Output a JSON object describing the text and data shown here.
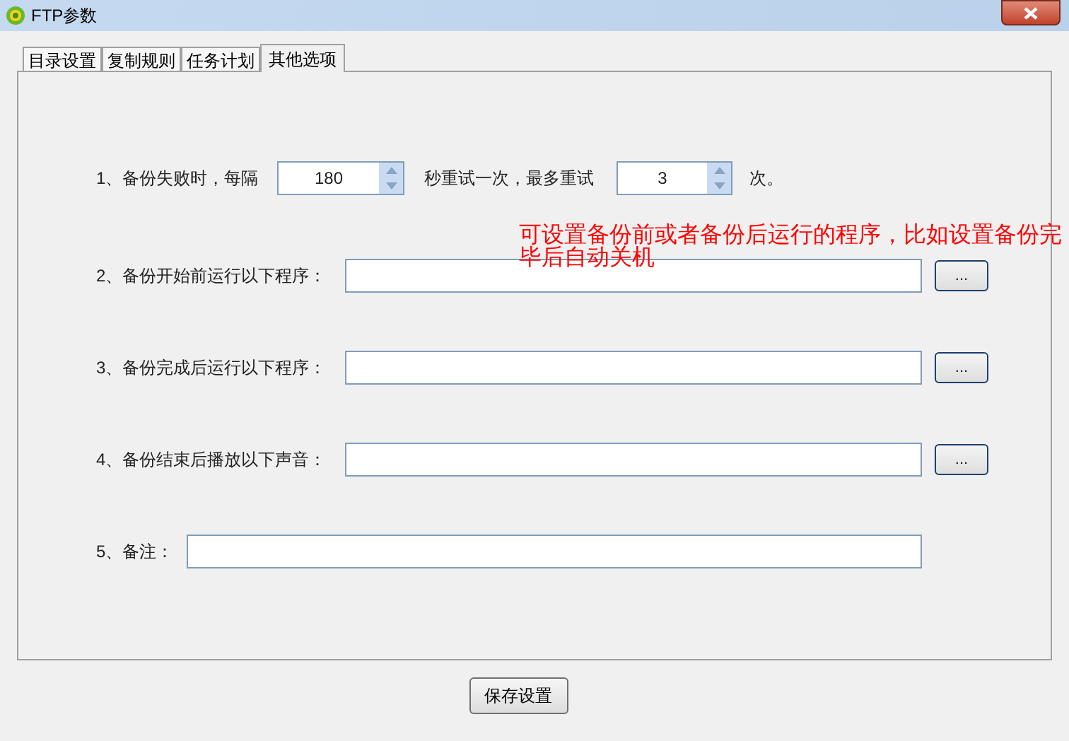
{
  "window": {
    "title": "FTP参数"
  },
  "tabs": [
    {
      "label": "目录设置",
      "selected": false
    },
    {
      "label": "复制规则",
      "selected": false
    },
    {
      "label": "任务计划",
      "selected": false
    },
    {
      "label": "其他选项",
      "selected": true
    }
  ],
  "retry": {
    "prefix": "1、备份失败时，每隔",
    "interval": "180",
    "middle": "秒重试一次，最多重试",
    "count": "3",
    "suffix": "次。"
  },
  "program_rows": [
    {
      "label": "2、备份开始前运行以下程序：",
      "button": "..."
    },
    {
      "label": "3、备份完成后运行以下程序：",
      "button": "..."
    },
    {
      "label": "4、备份结束后播放以下声音：",
      "button": "..."
    }
  ],
  "note": {
    "label": "5、备注："
  },
  "annotation": "可设置备份前或者备份后运行的程序，比如设置备份完毕后自动关机",
  "save_button": "保存设置"
}
